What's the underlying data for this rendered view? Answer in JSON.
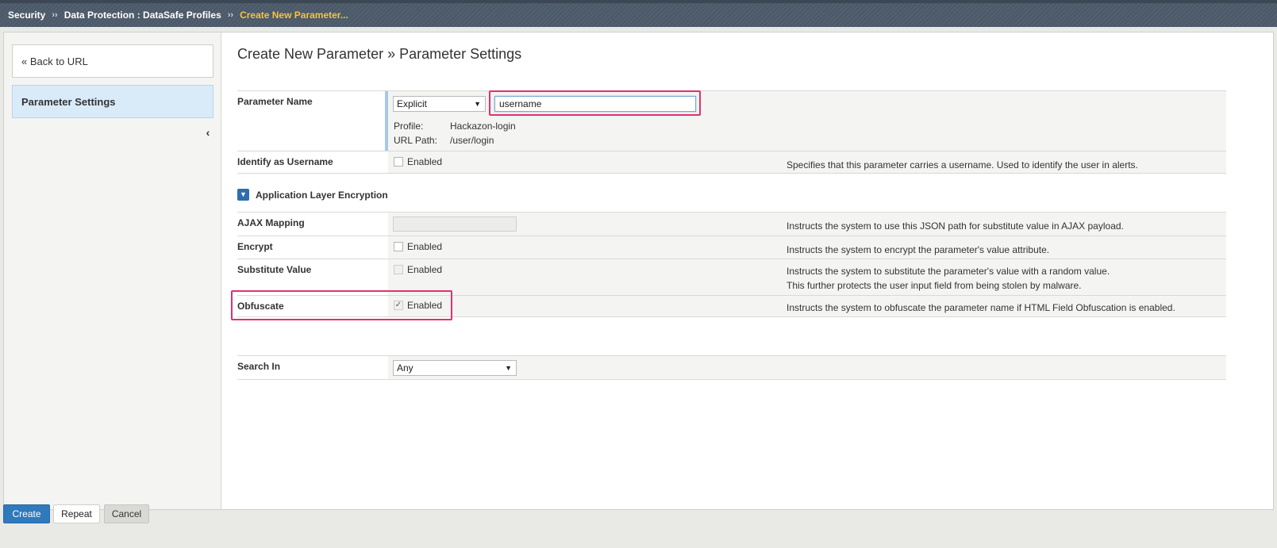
{
  "breadcrumb": {
    "items": [
      "Security",
      "Data Protection : DataSafe Profiles",
      "Create New Parameter..."
    ],
    "separator": "››"
  },
  "sidebar": {
    "back_label": "« Back to URL",
    "active_label": "Parameter Settings",
    "collapse_icon": "‹"
  },
  "page": {
    "title": "Create New Parameter » Parameter Settings"
  },
  "form": {
    "parameter_name": {
      "label": "Parameter Name",
      "type_value": "Explicit",
      "name_value": "username",
      "profile_label": "Profile:",
      "profile_value": "Hackazon-login",
      "url_path_label": "URL Path:",
      "url_path_value": "/user/login"
    },
    "identify_username": {
      "label": "Identify as Username",
      "checkbox_label": "Enabled",
      "checked": false,
      "description": "Specifies that this parameter carries a username. Used to identify the user in alerts."
    },
    "section_title": "Application Layer Encryption",
    "ajax_mapping": {
      "label": "AJAX Mapping",
      "description": "Instructs the system to use this JSON path for substitute value in AJAX payload."
    },
    "encrypt": {
      "label": "Encrypt",
      "checkbox_label": "Enabled",
      "checked": false,
      "description": "Instructs the system to encrypt the parameter's value attribute."
    },
    "substitute_value": {
      "label": "Substitute Value",
      "checkbox_label": "Enabled",
      "checked": false,
      "description_line1": "Instructs the system to substitute the parameter's value with a random value.",
      "description_line2": "This further protects the user input field from being stolen by malware."
    },
    "obfuscate": {
      "label": "Obfuscate",
      "checkbox_label": "Enabled",
      "checked": true,
      "checkmark": "✓",
      "description": "Instructs the system to obfuscate the parameter name if HTML Field Obfuscation is enabled."
    },
    "search_in": {
      "label": "Search In",
      "value": "Any"
    }
  },
  "buttons": {
    "create": "Create",
    "repeat": "Repeat",
    "cancel": "Cancel"
  },
  "colors": {
    "highlight": "#e2306f",
    "primary": "#2f79bd",
    "breadcrumb_current": "#f5c341"
  }
}
